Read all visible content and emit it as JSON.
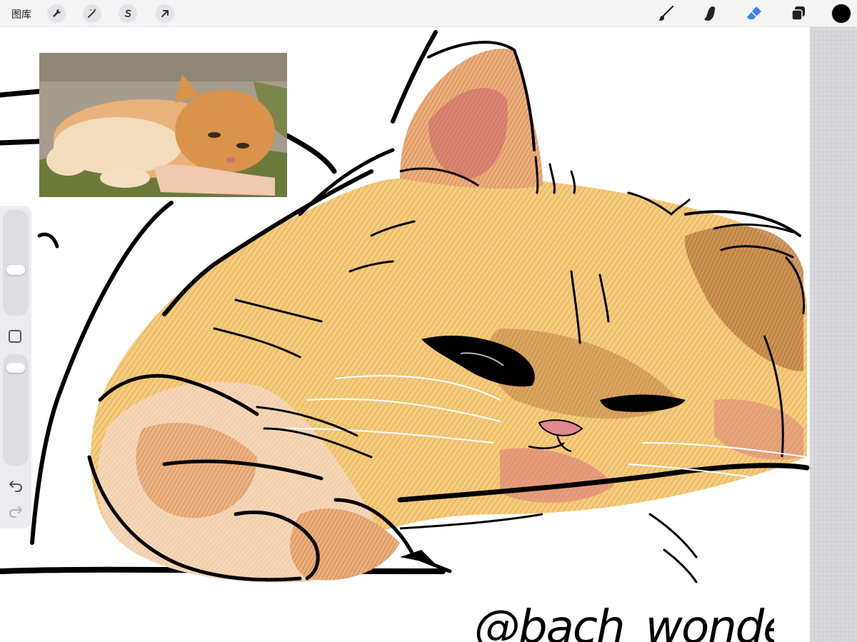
{
  "toolbar": {
    "gallery_label": "图库",
    "left_tools": [
      {
        "name": "actions",
        "icon": "wrench-icon"
      },
      {
        "name": "adjustments",
        "icon": "magic-wand-icon"
      },
      {
        "name": "selection",
        "icon": "selection-s-icon"
      },
      {
        "name": "transform",
        "icon": "arrow-cursor-icon"
      }
    ],
    "right_tools": [
      {
        "name": "brush",
        "icon": "brush-icon",
        "active": false
      },
      {
        "name": "smudge",
        "icon": "smudge-finger-icon",
        "active": false
      },
      {
        "name": "eraser",
        "icon": "eraser-icon",
        "active": true
      },
      {
        "name": "layers",
        "icon": "layers-icon",
        "active": false
      }
    ],
    "current_color": "#000000",
    "active_tool_color": "#3b82f6"
  },
  "sidebar": {
    "brush_size_level": 0.24,
    "opacity_level": 1.0,
    "modify_button_icon": "square-icon",
    "undo_icon": "undo-icon",
    "redo_icon": "redo-icon"
  },
  "reference_window": {
    "subject": "photo-of-orange-cat",
    "fur_color": "#d9934a",
    "background_color": "#a59c8e",
    "blanket_color": "#6b7a3a"
  },
  "artwork": {
    "subject": "sketch-of-sleeping-orange-cat",
    "palette": [
      "#f2c36b",
      "#e8a15a",
      "#d8875f",
      "#c96a5e",
      "#8a5a2e",
      "#000000"
    ],
    "signature": "@bach_wonder"
  }
}
